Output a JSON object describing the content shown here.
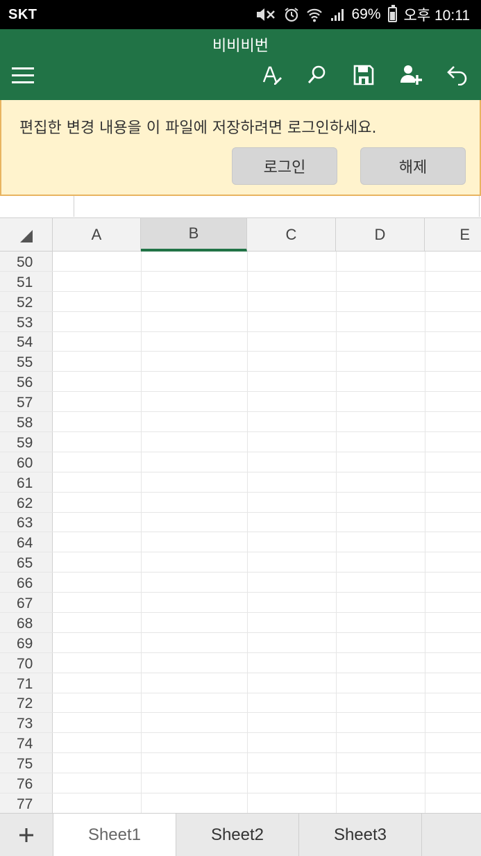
{
  "status": {
    "carrier": "SKT",
    "battery": "69%",
    "battery_level": 0.69,
    "time": "오후 10:11"
  },
  "app": {
    "title": "비비비번",
    "icons": [
      "menu-icon",
      "font-format-icon",
      "search-icon",
      "save-icon",
      "share-user-icon",
      "undo-icon"
    ],
    "accent_color": "#217346"
  },
  "banner": {
    "message": "편집한 변경 내용을 이 파일에 저장하려면 로그인하세요.",
    "login_label": "로그인",
    "dismiss_label": "해제"
  },
  "grid": {
    "columns": [
      "A",
      "B",
      "C",
      "D",
      "E"
    ],
    "selected_column": "B",
    "rows": [
      "50",
      "51",
      "52",
      "53",
      "54",
      "55",
      "56",
      "57",
      "58",
      "59",
      "60",
      "61",
      "62",
      "63",
      "64",
      "65",
      "66",
      "67",
      "68",
      "69",
      "70",
      "71",
      "72",
      "73",
      "74",
      "75",
      "76",
      "77"
    ]
  },
  "sheets": {
    "add_label": "+",
    "tabs": [
      "Sheet1",
      "Sheet2",
      "Sheet3"
    ],
    "active": "Sheet1"
  }
}
